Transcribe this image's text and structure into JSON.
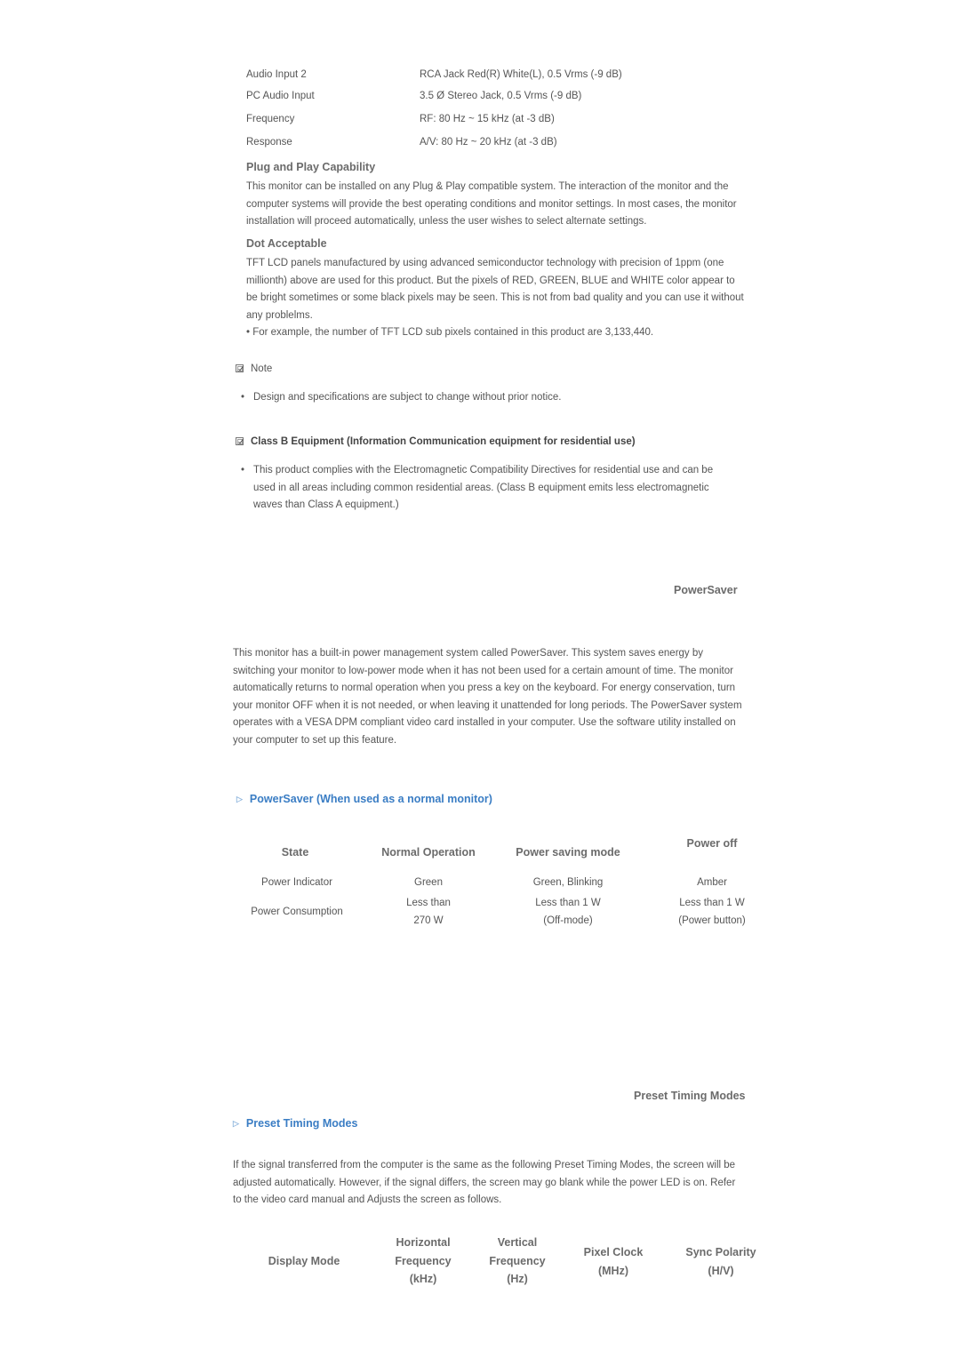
{
  "audio_specs": [
    {
      "label": "Audio Input 2",
      "value": "RCA Jack Red(R) White(L), 0.5 Vrms (-9 dB)"
    },
    {
      "label": "PC Audio Input",
      "value": "3.5 Ø Stereo Jack, 0.5 Vrms (-9 dB)"
    },
    {
      "label": "Frequency",
      "value": "RF: 80 Hz ~ 15 kHz (at -3 dB)"
    },
    {
      "label": "Response",
      "value": "A/V: 80 Hz ~ 20 kHz (at -3 dB)"
    }
  ],
  "plug_and_play": {
    "title": "Plug and Play Capability",
    "lines": [
      "This monitor can be installed on any Plug & Play compatible system. The interaction of the monitor and the",
      "computer systems will provide the best operating conditions and monitor settings. In most cases, the monitor",
      "installation will proceed automatically, unless the user wishes to select alternate settings."
    ]
  },
  "dot_acceptable": {
    "title": "Dot Acceptable",
    "lines": [
      "TFT LCD panels manufactured by using advanced semiconductor technology with precision of 1ppm (one",
      "millionth) above are used for this product. But the pixels of RED, GREEN, BLUE and WHITE color appear to",
      "be bright sometimes or some black pixels may be seen. This is not from bad quality and you can use it without",
      "any problelms.",
      "• For example, the number of TFT LCD sub pixels contained in this product are 3,133,440."
    ]
  },
  "note": {
    "icon": "checkbox-note-icon",
    "label": "Note",
    "bullet": "Design and specifications are subject to change without prior notice."
  },
  "class_b": {
    "icon": "checkbox-note-icon",
    "label": "Class B Equipment (Information Communication equipment for residential use)",
    "bullet_lines": [
      "This product complies with the Electromagnetic Compatibility Directives for residential use and can be",
      "used in all areas including common residential areas. (Class B equipment emits less electromagnetic",
      "waves than Class A equipment.)"
    ]
  },
  "powersaver": {
    "section_title": "PowerSaver",
    "lines": [
      "This monitor has a built-in power management system called PowerSaver. This system saves energy by",
      "switching your monitor to low-power mode when it has not been used for a certain amount of time. The monitor",
      "automatically returns to normal operation when you press a key on the keyboard. For energy conservation, turn",
      "your monitor OFF when it is not needed, or when leaving it unattended for long periods. The PowerSaver system",
      "operates with a VESA DPM compliant video card installed in your computer. Use the software utility installed on",
      "your computer to set up this feature."
    ],
    "subheading": "PowerSaver (When used as a normal monitor)",
    "table": {
      "headers": [
        "State",
        "Normal Operation",
        "Power saving mode",
        "Power off"
      ],
      "rows": [
        [
          "Power Indicator",
          "Green",
          "Green, Blinking",
          "Amber"
        ],
        [
          "Power Consumption",
          [
            "Less than",
            "270 W"
          ],
          [
            "Less than 1 W",
            "(Off-mode)"
          ],
          [
            "Less than 1 W",
            "(Power button)"
          ]
        ]
      ]
    }
  },
  "preset_timing": {
    "section_title": "Preset Timing Modes",
    "subheading": "Preset Timing Modes",
    "lines": [
      "If the signal transferred from the computer is the same as the following Preset Timing Modes, the screen will be",
      "adjusted automatically. However, if the signal differs, the screen may go blank while the power LED is on. Refer",
      "to the video card manual and Adjusts the screen as follows."
    ],
    "table_headers": [
      [
        "Display Mode"
      ],
      [
        "Horizontal",
        "Frequency",
        "(kHz)"
      ],
      [
        "Vertical",
        "Frequency",
        "(Hz)"
      ],
      [
        "Pixel Clock",
        "(MHz)"
      ],
      [
        "Sync Polarity",
        "(H/V)"
      ]
    ]
  }
}
